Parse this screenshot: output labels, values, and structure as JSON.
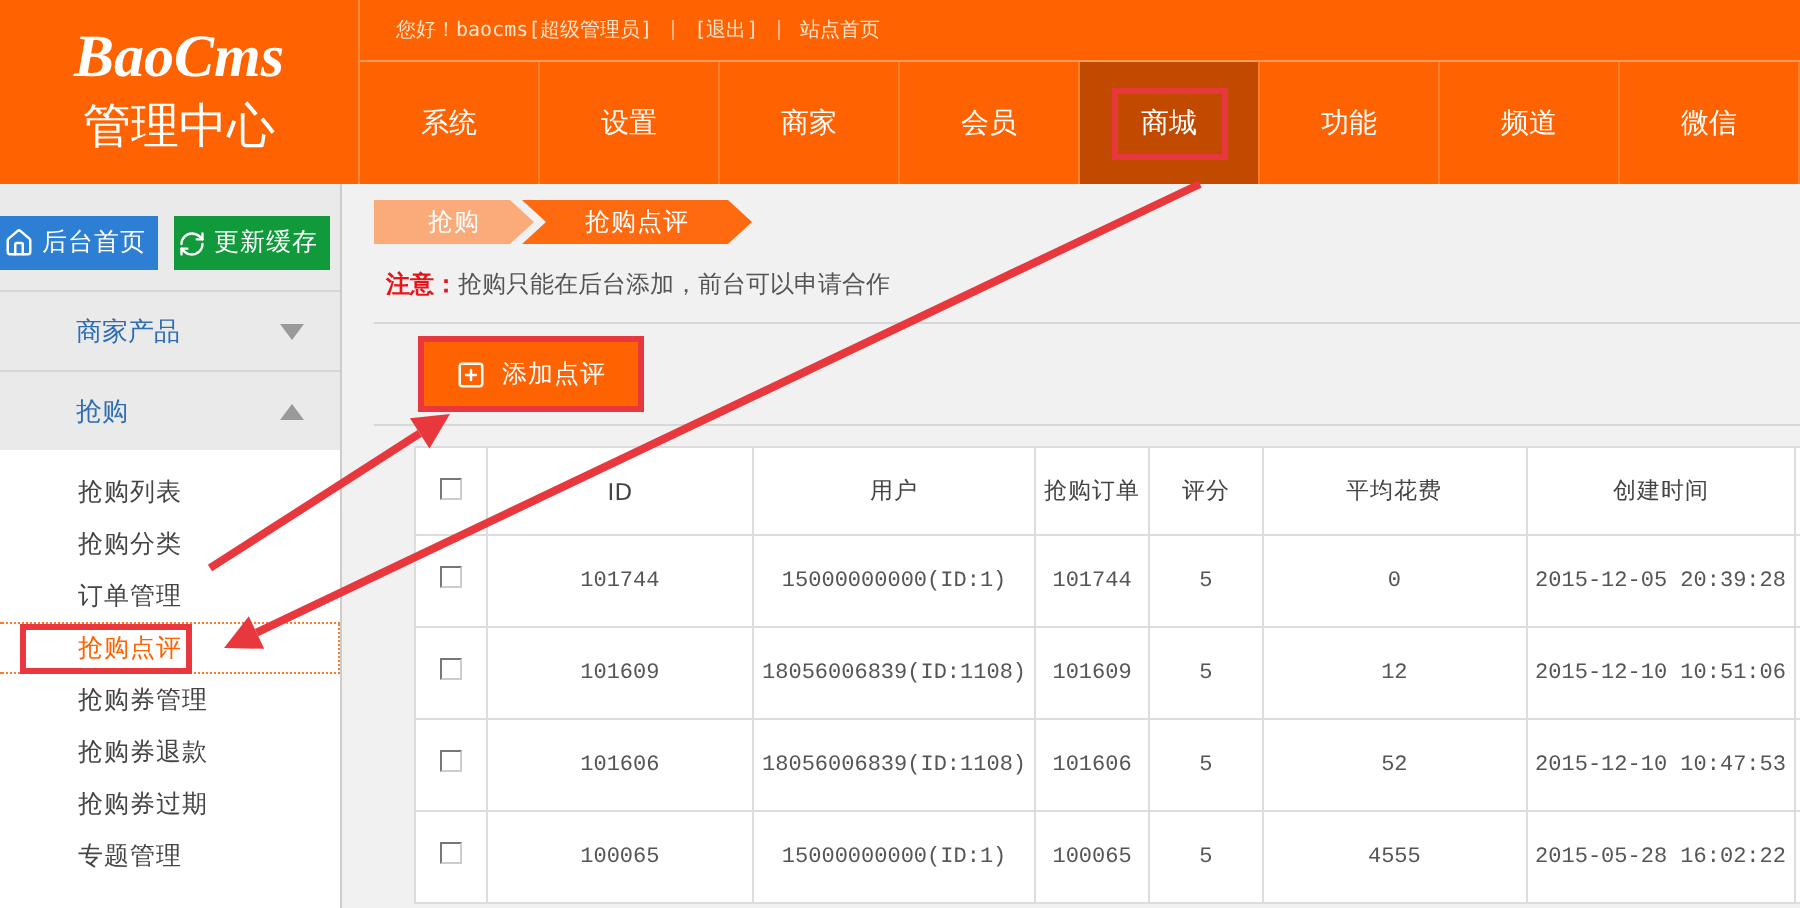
{
  "logo": {
    "brand": "BaoCms",
    "subtitle": "管理中心"
  },
  "top_bar": {
    "greeting": "您好！baocms[超级管理员]",
    "links": [
      "[退出]",
      "站点首页"
    ]
  },
  "nav": [
    {
      "label": "系统",
      "selected": false,
      "highlighted": false
    },
    {
      "label": "设置",
      "selected": false,
      "highlighted": false
    },
    {
      "label": "商家",
      "selected": false,
      "highlighted": false
    },
    {
      "label": "会员",
      "selected": false,
      "highlighted": false
    },
    {
      "label": "商城",
      "selected": true,
      "highlighted": true
    },
    {
      "label": "功能",
      "selected": false,
      "highlighted": false
    },
    {
      "label": "频道",
      "selected": false,
      "highlighted": false
    },
    {
      "label": "微信",
      "selected": false,
      "highlighted": false
    }
  ],
  "sidebar": {
    "buttons": [
      {
        "label": "后台首页",
        "kind": "home"
      },
      {
        "label": "更新缓存",
        "kind": "refresh"
      }
    ],
    "sections": [
      {
        "label": "商家产品",
        "expanded": false
      },
      {
        "label": "抢购",
        "expanded": true
      }
    ],
    "items": [
      {
        "label": "抢购列表",
        "selected": false,
        "highlighted": false
      },
      {
        "label": "抢购分类",
        "selected": false,
        "highlighted": false
      },
      {
        "label": "订单管理",
        "selected": false,
        "highlighted": false
      },
      {
        "label": "抢购点评",
        "selected": true,
        "highlighted": true
      },
      {
        "label": "抢购券管理",
        "selected": false,
        "highlighted": false
      },
      {
        "label": "抢购券退款",
        "selected": false,
        "highlighted": false
      },
      {
        "label": "抢购券过期",
        "selected": false,
        "highlighted": false
      },
      {
        "label": "专题管理",
        "selected": false,
        "highlighted": false
      }
    ]
  },
  "breadcrumb": [
    "抢购",
    "抢购点评"
  ],
  "notice": {
    "label": "注意：",
    "text": "抢购只能在后台添加，前台可以申请合作"
  },
  "add_button": {
    "label": "添加点评",
    "highlighted": true
  },
  "table": {
    "select_all_checked": false,
    "columns": [
      "ID",
      "用户",
      "抢购订单",
      "评分",
      "平均花费",
      "创建时间"
    ],
    "rows": [
      {
        "checked": false,
        "cells": [
          "101744",
          "15000000000(ID:1)",
          "101744",
          "5",
          "0",
          "2015-12-05 20:39:28"
        ]
      },
      {
        "checked": false,
        "cells": [
          "101609",
          "18056006839(ID:1108)",
          "101609",
          "5",
          "12",
          "2015-12-10 10:51:06"
        ]
      },
      {
        "checked": false,
        "cells": [
          "101606",
          "18056006839(ID:1108)",
          "101606",
          "5",
          "52",
          "2015-12-10 10:47:53"
        ]
      },
      {
        "checked": false,
        "cells": [
          "100065",
          "15000000000(ID:1)",
          "100065",
          "5",
          "4555",
          "2015-05-28 16:02:22"
        ]
      }
    ]
  }
}
